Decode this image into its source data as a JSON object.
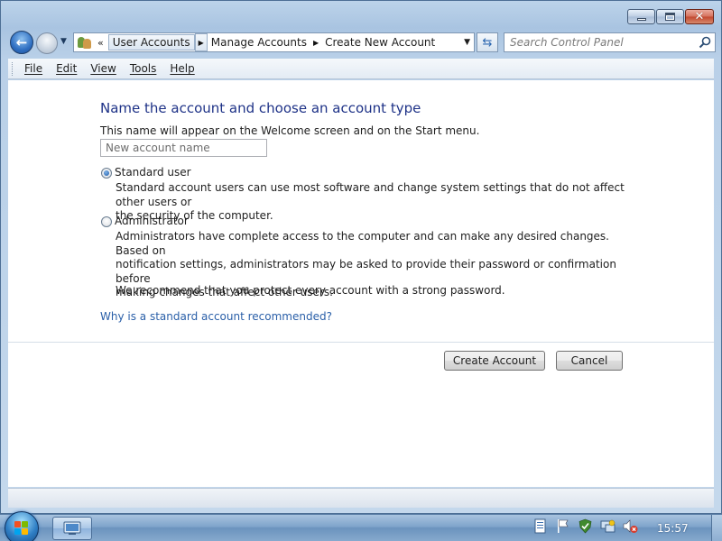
{
  "window": {
    "minimize_icon": "minimize-icon",
    "maximize_icon": "maximize-icon",
    "close_icon": "close-icon"
  },
  "nav": {
    "breadcrumbs": [
      "User Accounts",
      "Manage Accounts",
      "Create New Account"
    ],
    "overflow_glyph": "«",
    "search_placeholder": "Search Control Panel"
  },
  "menu": {
    "items": [
      "File",
      "Edit",
      "View",
      "Tools",
      "Help"
    ]
  },
  "page": {
    "heading": "Name the account and choose an account type",
    "subtext": "This name will appear on the Welcome screen and on the Start menu.",
    "name_placeholder": "New account name",
    "name_value": "",
    "options": [
      {
        "label": "Standard user",
        "checked": true,
        "description": [
          "Standard account users can use most software and change system settings that do not affect other users or",
          "the security of the computer."
        ]
      },
      {
        "label": "Administrator",
        "checked": false,
        "description": [
          "Administrators have complete access to the computer and can make any desired changes. Based on",
          "notification settings, administrators may be asked to provide their password or confirmation before",
          "making changes that affect other users."
        ]
      }
    ],
    "recommendation": "We recommend that you protect every account with a strong password.",
    "help_link": "Why is a standard account recommended?",
    "create_button": "Create Account",
    "cancel_button": "Cancel"
  },
  "taskbar": {
    "clock": "15:57",
    "tray_icons": [
      "document-icon",
      "flag-icon",
      "security-shield-icon",
      "network-icon",
      "volume-muted-icon"
    ]
  },
  "colors": {
    "heading": "#1e3287",
    "link": "#2a5fa8",
    "close_button": "#c2462d"
  }
}
